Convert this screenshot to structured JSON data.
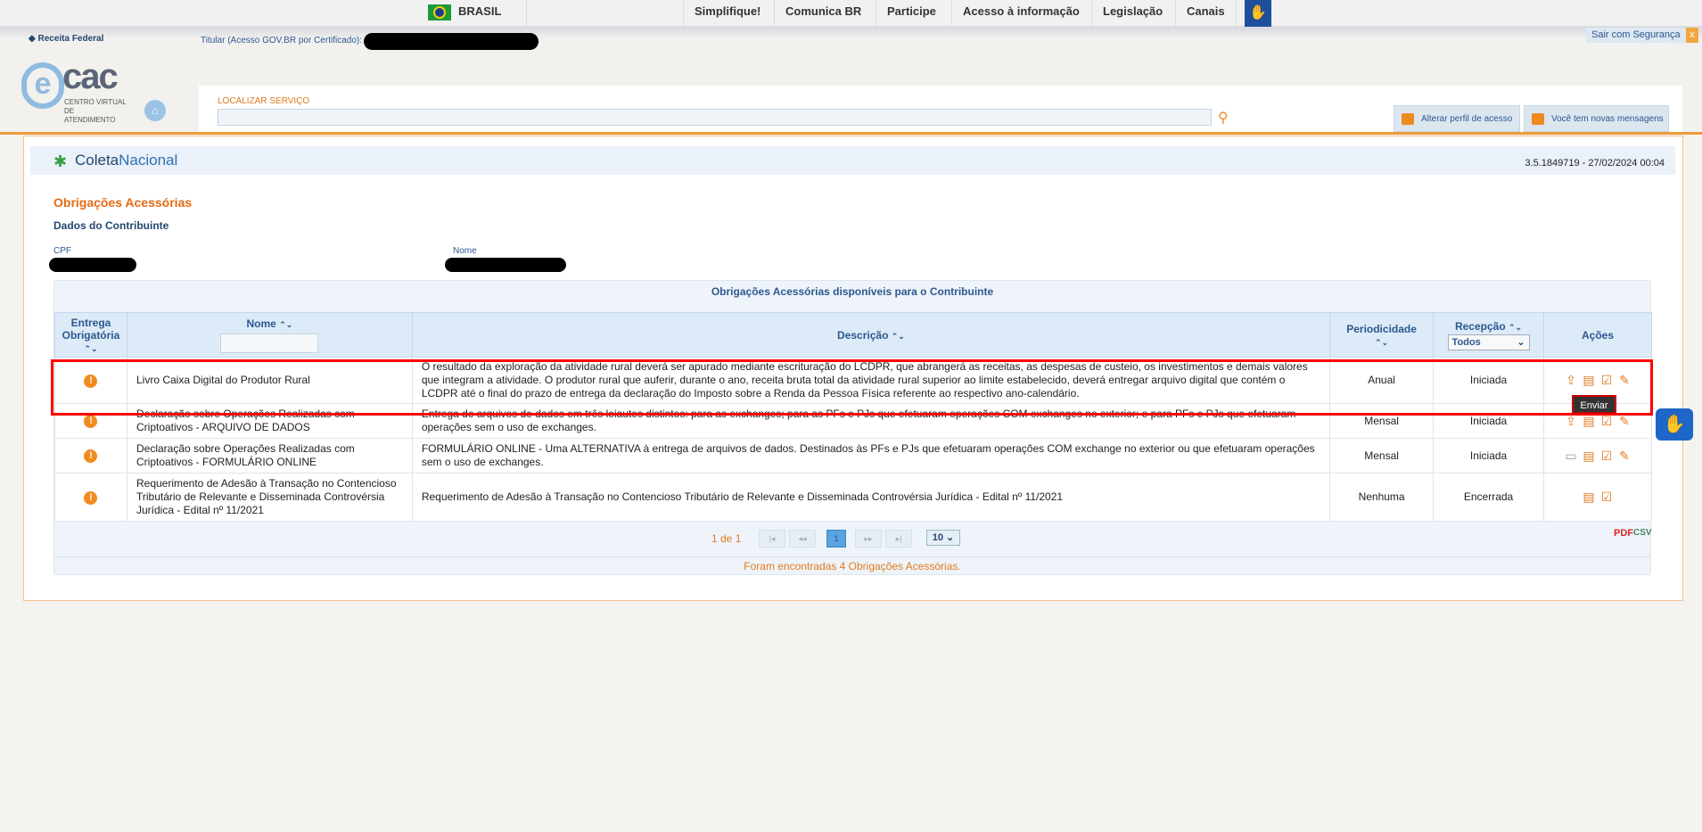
{
  "gov_bar": {
    "country": "BRASIL",
    "links": [
      "Simplifique!",
      "Comunica BR",
      "Participe",
      "Acesso à informação",
      "Legislação",
      "Canais"
    ]
  },
  "header": {
    "brand": "Receita Federal",
    "titular_label": "Titular (Acesso GOV.BR por Certificado):",
    "logout": "Sair com Segurança",
    "logout_close": "x",
    "ecac_e": "e",
    "ecac_cac": "cac",
    "ecac_sub": "CENTRO VIRTUAL DE ATENDIMENTO",
    "search_label": "LOCALIZAR SERVIÇO",
    "search_value": "",
    "btn_profile": "Alterar perfil de acesso",
    "btn_messages": "Você tem novas mensagens"
  },
  "app": {
    "coleta": "Coleta",
    "nacional": "Nacional",
    "version": "3.5.1849719 - 27/02/2024 00:04"
  },
  "page": {
    "title": "Obrigações Acessórias",
    "subtitle": "Dados do Contribuinte",
    "cpf_label": "CPF",
    "nome_label": "Nome"
  },
  "table": {
    "caption": "Obrigações Acessórias disponíveis para o Contribuinte",
    "headers": {
      "entrega": "Entrega Obrigatória",
      "nome": "Nome",
      "descricao": "Descrição",
      "periodicidade": "Periodicidade",
      "recepcao": "Recepção",
      "acoes": "Ações"
    },
    "recepcao_filter": "Todos",
    "rows": [
      {
        "nome": "Livro Caixa Digital do Produtor Rural",
        "descricao": "O resultado da exploração da atividade rural deverá ser apurado mediante escrituração do LCDPR, que abrangerá as receitas, as despesas de custeio, os investimentos e demais valores que integram a atividade. O produtor rural que auferir, durante o ano, receita bruta total da atividade rural superior ao limite estabelecido, deverá entregar arquivo digital que contém o LCDPR até o final do prazo de entrega da declaração do Imposto sobre a Renda da Pessoa Física referente ao respectivo ano-calendário.",
        "periodicidade": "Anual",
        "recepcao": "Iniciada"
      },
      {
        "nome": "Declaração sobre Operações Realizadas com Criptoativos - ARQUIVO DE DADOS",
        "descricao": "Entrega de arquivos de dados em três leiautes distintos: para as exchanges; para as PFs e PJs que efetuaram operações COM exchanges no exterior; e para PFs e PJs que efetuaram operações sem o uso de exchanges.",
        "periodicidade": "Mensal",
        "recepcao": "Iniciada"
      },
      {
        "nome": "Declaração sobre Operações Realizadas com Criptoativos - FORMULÁRIO ONLINE",
        "descricao": "FORMULÁRIO ONLINE - Uma ALTERNATIVA à entrega de arquivos de dados. Destinados às PFs e PJs que efetuaram operações COM exchange no exterior ou que efetuaram operações sem o uso de exchanges.",
        "periodicidade": "Mensal",
        "recepcao": "Iniciada"
      },
      {
        "nome": "Requerimento de Adesão à Transação no Contencioso Tributário de Relevante e Disseminada Controvérsia Jurídica - Edital nº 11/2021",
        "descricao": "Requerimento de Adesão à Transação no Contencioso Tributário de Relevante e Disseminada Controvérsia Jurídica - Edital nº 11/2021",
        "periodicidade": "Nenhuma",
        "recepcao": "Encerrada"
      }
    ],
    "tooltip": "Enviar",
    "pagination": {
      "of": "1 de 1",
      "current": "1",
      "page_size": "10"
    },
    "footer": "Foram encontradas 4 Obrigações Acessórias."
  },
  "colors": {
    "accent": "#e66a12",
    "blue": "#2c5890",
    "highlight": "#ff0000"
  }
}
